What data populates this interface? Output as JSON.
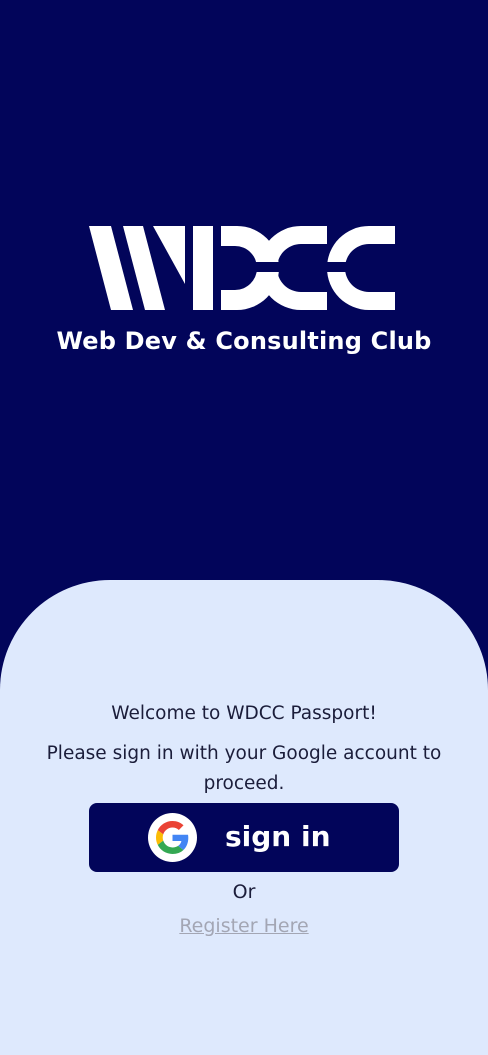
{
  "brand": {
    "logo_text": "WDCC",
    "tagline": "Web Dev & Consulting Club"
  },
  "panel": {
    "welcome": "Welcome to WDCC Passport!",
    "instruction": "Please sign in with your Google account to proceed.",
    "signin_label": "sign in",
    "signin_icon": "google-icon",
    "or_text": "Or",
    "register_link": "Register Here"
  },
  "colors": {
    "navy": "#02055a",
    "panel_bg": "#dee9fd",
    "text": "#1b1d3a",
    "link": "#a3a6b4"
  }
}
